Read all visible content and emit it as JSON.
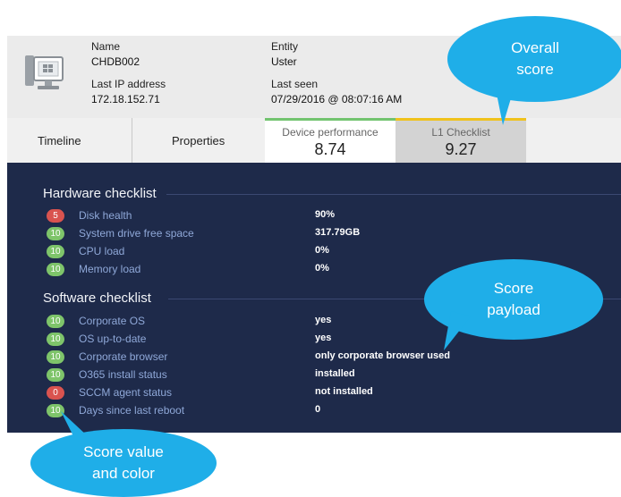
{
  "header": {
    "name_label": "Name",
    "name_value": "CHDB002",
    "ip_label": "Last IP address",
    "ip_value": "172.18.152.71",
    "entity_label": "Entity",
    "entity_value": "Uster",
    "seen_label": "Last seen",
    "seen_value": "07/29/2016 @ 08:07:16 AM"
  },
  "tabs": {
    "timeline": "Timeline",
    "properties": "Properties",
    "device_performance": {
      "label": "Device performance",
      "value": "8.74"
    },
    "l1_checklist": {
      "label": "L1 Checklist",
      "value": "9.27"
    }
  },
  "hardware": {
    "title": "Hardware checklist",
    "items": [
      {
        "score": "5",
        "color": "red",
        "label": "Disk health",
        "value": "90%"
      },
      {
        "score": "10",
        "color": "green",
        "label": "System drive free space",
        "value": "317.79GB"
      },
      {
        "score": "10",
        "color": "green",
        "label": "CPU load",
        "value": "0%"
      },
      {
        "score": "10",
        "color": "green",
        "label": "Memory load",
        "value": "0%"
      }
    ]
  },
  "software": {
    "title": "Software checklist",
    "items": [
      {
        "score": "10",
        "color": "green",
        "label": "Corporate OS",
        "value": "yes"
      },
      {
        "score": "10",
        "color": "green",
        "label": "OS up-to-date",
        "value": "yes"
      },
      {
        "score": "10",
        "color": "green",
        "label": "Corporate browser",
        "value": "only corporate browser used"
      },
      {
        "score": "10",
        "color": "green",
        "label": "O365 install status",
        "value": "installed"
      },
      {
        "score": "0",
        "color": "red",
        "label": "SCCM agent status",
        "value": "not installed"
      },
      {
        "score": "10",
        "color": "green",
        "label": "Days since last reboot",
        "value": "0"
      }
    ]
  },
  "callouts": {
    "overall": [
      "Overall",
      "score"
    ],
    "payload": [
      "Score",
      "payload"
    ],
    "value_color": [
      "Score value",
      "and color"
    ]
  },
  "colors": {
    "panel_bg": "#1e2a4a",
    "badge_green": "#7ec46a",
    "badge_red": "#d9534f",
    "callout": "#1faee8",
    "perf_accent": "#72c36f",
    "l1_accent": "#f0c21c"
  },
  "icons": {
    "device": "monitor-windows-icon"
  }
}
